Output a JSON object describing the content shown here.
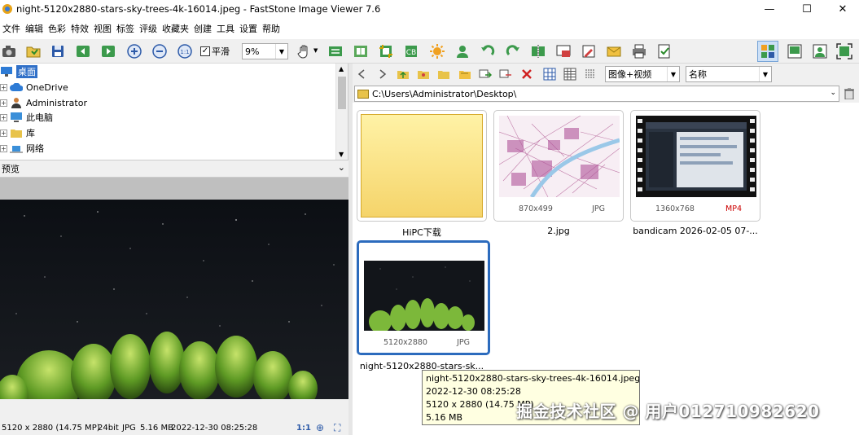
{
  "window": {
    "title": "night-5120x2880-stars-sky-trees-4k-16014.jpeg  -  FastStone Image Viewer 7.6",
    "minimize": "—",
    "maximize": "☐",
    "close": "✕"
  },
  "menu": [
    "文件",
    "编辑",
    "色彩",
    "特效",
    "视图",
    "标签",
    "评级",
    "收藏夹",
    "创建",
    "工具",
    "设置",
    "帮助"
  ],
  "toolbar": {
    "smooth_label": "平滑",
    "zoom_value": "9%"
  },
  "tree": {
    "items": [
      {
        "label": "桌面",
        "icon": "desktop-icon"
      },
      {
        "label": "OneDrive",
        "icon": "cloud-icon"
      },
      {
        "label": "Administrator",
        "icon": "user-icon"
      },
      {
        "label": "此电脑",
        "icon": "computer-icon"
      },
      {
        "label": "库",
        "icon": "library-icon"
      },
      {
        "label": "网络",
        "icon": "network-icon"
      }
    ]
  },
  "preview": {
    "header": "预览",
    "collapse_glyph": "⌄"
  },
  "status": {
    "dims": "5120 x 2880 (14.75 MP)",
    "bits": "24bit",
    "format": "JPG",
    "size": "5.16 MB",
    "date": "2022-12-30 08:25:28",
    "ratio": "1:1"
  },
  "nav": {
    "filter": "图像+视频",
    "sort": "名称"
  },
  "path": "C:\\Users\\Administrator\\Desktop\\",
  "thumbnails": [
    {
      "caption": "HiPC下载",
      "dims": "",
      "type": "",
      "kind": "folder"
    },
    {
      "caption": "2.jpg",
      "dims": "870x499",
      "type": "JPG",
      "kind": "map"
    },
    {
      "caption": "bandicam 2026-02-05 07-...",
      "dims": "1360x768",
      "type": "MP4",
      "kind": "video"
    },
    {
      "caption": "night-5120x2880-stars-sk...",
      "dims": "5120x2880",
      "type": "JPG",
      "kind": "night"
    }
  ],
  "tooltip": {
    "line1": "night-5120x2880-stars-sky-trees-4k-16014.jpeg",
    "line2": "2022-12-30 08:25:28",
    "line3": "5120 x 2880 (14.75 MP)",
    "line4": "5.16 MB"
  },
  "watermark": "掘金技术社区 @ 用户012710982620",
  "colors": {
    "selection": "#2c6bbd",
    "mp4_label": "#cc0000",
    "folder": "#f5d76e"
  }
}
